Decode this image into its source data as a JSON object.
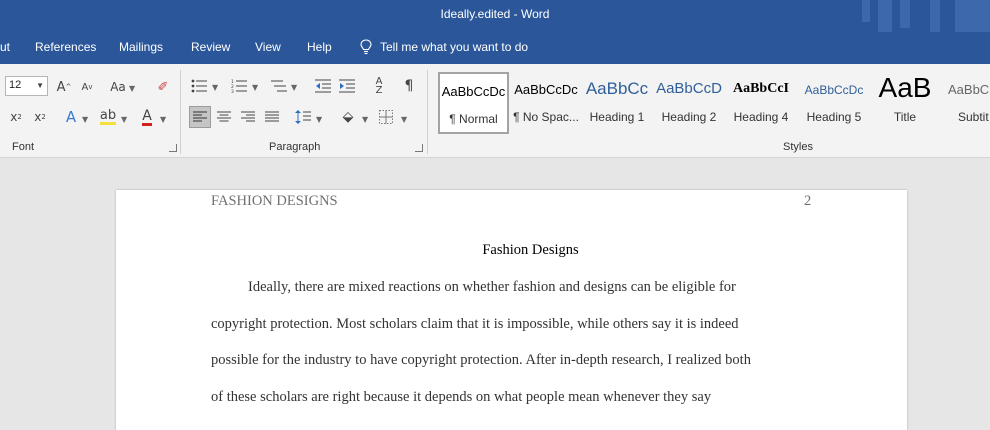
{
  "window": {
    "title": "Ideally.edited  -  Word"
  },
  "tabs": [
    "ut",
    "References",
    "Mailings",
    "Review",
    "View",
    "Help"
  ],
  "tell_me": {
    "placeholder": "Tell me what you want to do",
    "icon": "lightbulb-icon"
  },
  "ribbon": {
    "font_group": {
      "label": "Font",
      "font_size": "12"
    },
    "paragraph_group": {
      "label": "Paragraph"
    },
    "styles_group": {
      "label": "Styles",
      "items": [
        {
          "sample": "AaBbCcDc",
          "name": "¶ Normal",
          "selected": true
        },
        {
          "sample": "AaBbCcDc",
          "name": "¶ No Spac..."
        },
        {
          "sample": "AaBbCc",
          "name": "Heading 1"
        },
        {
          "sample": "AaBbCcD",
          "name": "Heading 2"
        },
        {
          "sample": "AaBbCcI",
          "name": "Heading 4"
        },
        {
          "sample": "AaBbCcDc",
          "name": "Heading 5"
        },
        {
          "sample": "AaB",
          "name": "Title"
        },
        {
          "sample": "AaBbC",
          "name": "Subtit"
        }
      ]
    }
  },
  "document": {
    "header_left": "FASHION DESIGNS",
    "page_number": "2",
    "title": "Fashion Designs",
    "lines": [
      "Ideally, there are mixed reactions on whether fashion and designs can be eligible for",
      "copyright protection.  Most scholars claim that it is impossible, while others say it is indeed",
      "possible for the industry to have copyright protection. After in-depth research, I realized both",
      "of these scholars are right because it depends on what people mean whenever they say"
    ]
  },
  "colors": {
    "title_bar": "#2b579a",
    "ribbon": "#f3f3f3",
    "canvas": "#e6e6e6",
    "page": "#ffffff"
  }
}
